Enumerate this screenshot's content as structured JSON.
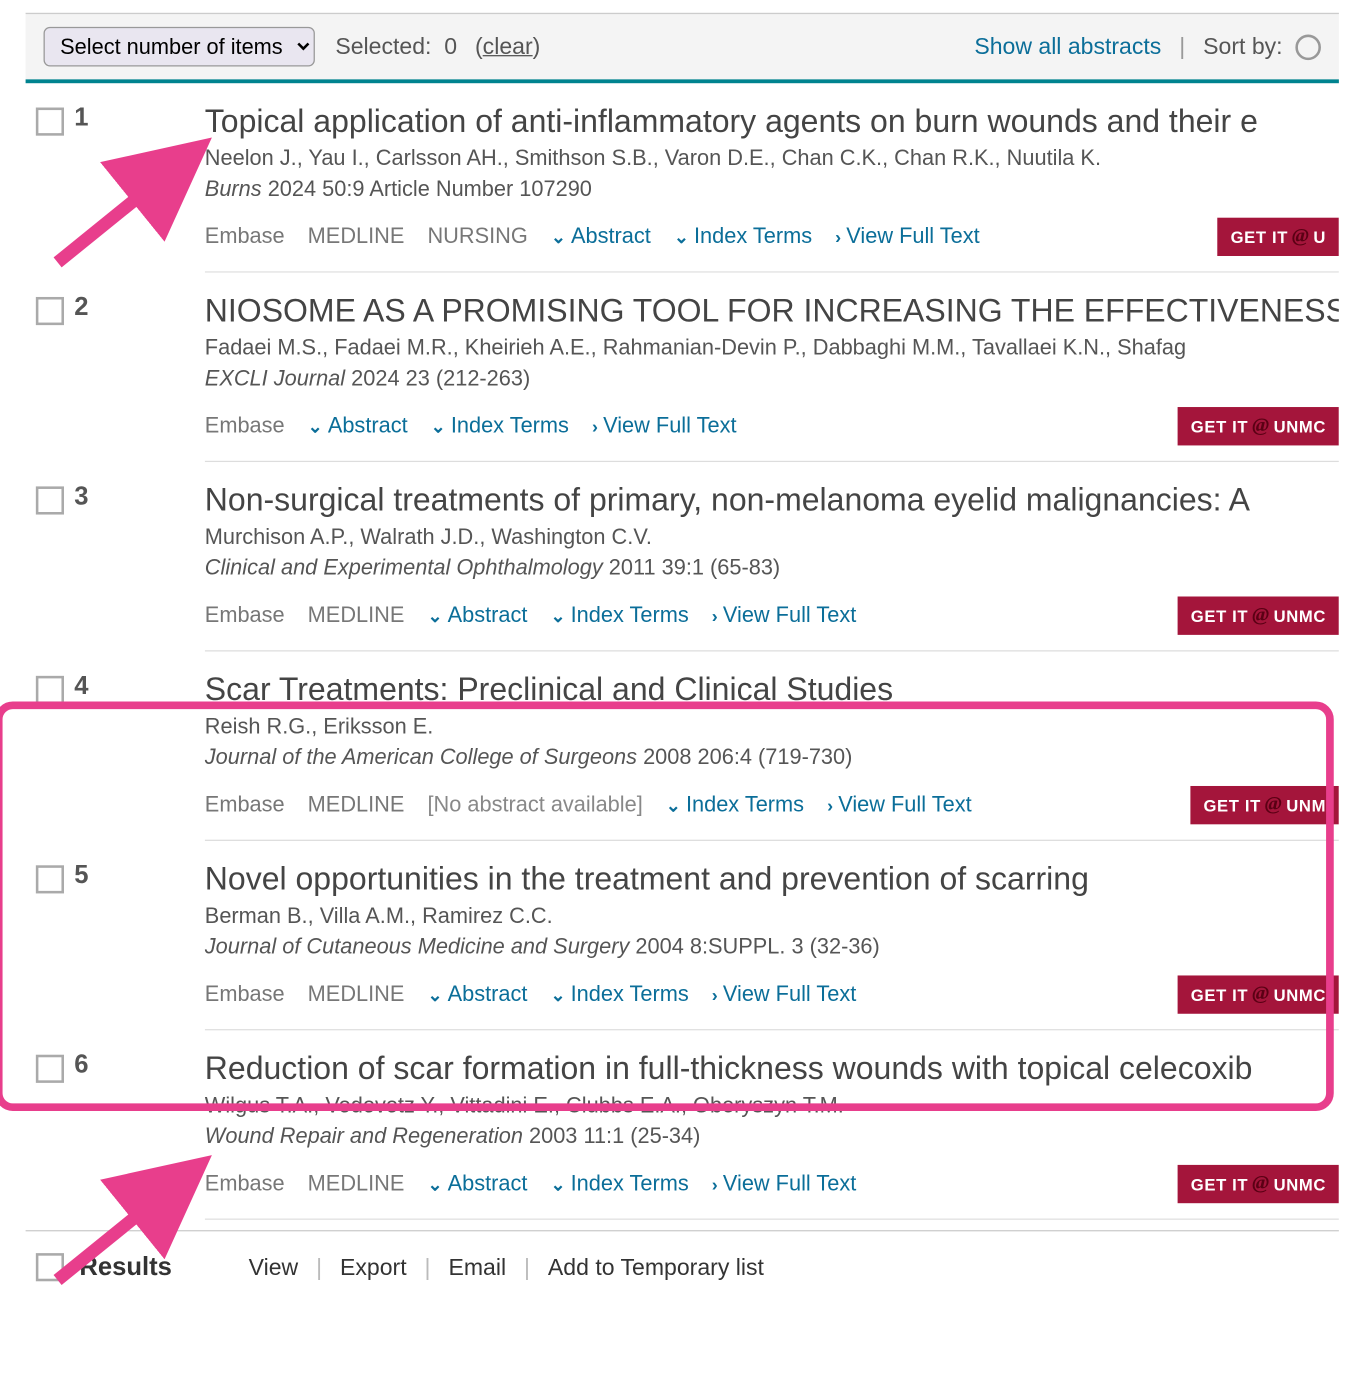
{
  "topbar": {
    "select_placeholder": "Select number of items",
    "selected_label": "Selected:",
    "selected_count": "0",
    "clear": "clear",
    "show_all": "Show all abstracts",
    "sort_by": "Sort by:"
  },
  "results": [
    {
      "num": "1",
      "title": "Topical application of anti-inflammatory agents on burn wounds and their e",
      "authors": "Neelon J., Yau I., Carlsson AH., Smithson S.B., Varon D.E., Chan C.K., Chan R.K., Nuutila K.",
      "journal": "Burns",
      "citation": "2024 50:9 Article Number 107290",
      "dbs": [
        "Embase",
        "MEDLINE",
        "NURSING"
      ],
      "abstract": true,
      "getit_suffix": "U"
    },
    {
      "num": "2",
      "title": "NIOSOME AS A PROMISING TOOL FOR INCREASING THE EFFECTIVENESS OF",
      "authors": "Fadaei M.S., Fadaei M.R., Kheirieh A.E., Rahmanian-Devin P., Dabbaghi M.M., Tavallaei K.N., Shafag",
      "journal": "EXCLI Journal",
      "citation": "2024 23 (212-263)",
      "dbs": [
        "Embase"
      ],
      "abstract": true,
      "getit_suffix": "UNMC"
    },
    {
      "num": "3",
      "title": "Non-surgical treatments of primary, non-melanoma eyelid malignancies: A",
      "authors": "Murchison A.P., Walrath J.D., Washington C.V.",
      "journal": "Clinical and Experimental Ophthalmology",
      "citation": "2011 39:1 (65-83)",
      "dbs": [
        "Embase",
        "MEDLINE"
      ],
      "abstract": true,
      "getit_suffix": "UNMC"
    },
    {
      "num": "4",
      "title": "Scar Treatments: Preclinical and Clinical Studies",
      "authors": "Reish R.G., Eriksson E.",
      "journal": "Journal of the American College of Surgeons",
      "citation": "2008 206:4 (719-730)",
      "dbs": [
        "Embase",
        "MEDLINE"
      ],
      "abstract": false,
      "getit_suffix": "UNM"
    },
    {
      "num": "5",
      "title": "Novel opportunities in the treatment and prevention of scarring",
      "authors": "Berman B., Villa A.M., Ramirez C.C.",
      "journal": "Journal of Cutaneous Medicine and Surgery",
      "citation": "2004 8:SUPPL. 3 (32-36)",
      "dbs": [
        "Embase",
        "MEDLINE"
      ],
      "abstract": true,
      "getit_suffix": "UNMC"
    },
    {
      "num": "6",
      "title": "Reduction of scar formation in full-thickness wounds with topical celecoxib",
      "authors": "Wilgus T.A., Vodovotz Y., Vittadini E., Clubbs E.A., Oberyszyn T.M.",
      "journal": "Wound Repair and Regeneration",
      "citation": "2003 11:1 (25-34)",
      "dbs": [
        "Embase",
        "MEDLINE"
      ],
      "abstract": true,
      "getit_suffix": "UNMC"
    }
  ],
  "labels": {
    "abstract": "Abstract",
    "index_terms": "Index Terms",
    "view_full": "View Full Text",
    "no_abstract": "[No abstract available]",
    "getit": "GET IT"
  },
  "footer": {
    "results": "Results",
    "view": "View",
    "export": "Export",
    "email": "Email",
    "addtemp": "Add to Temporary list"
  }
}
